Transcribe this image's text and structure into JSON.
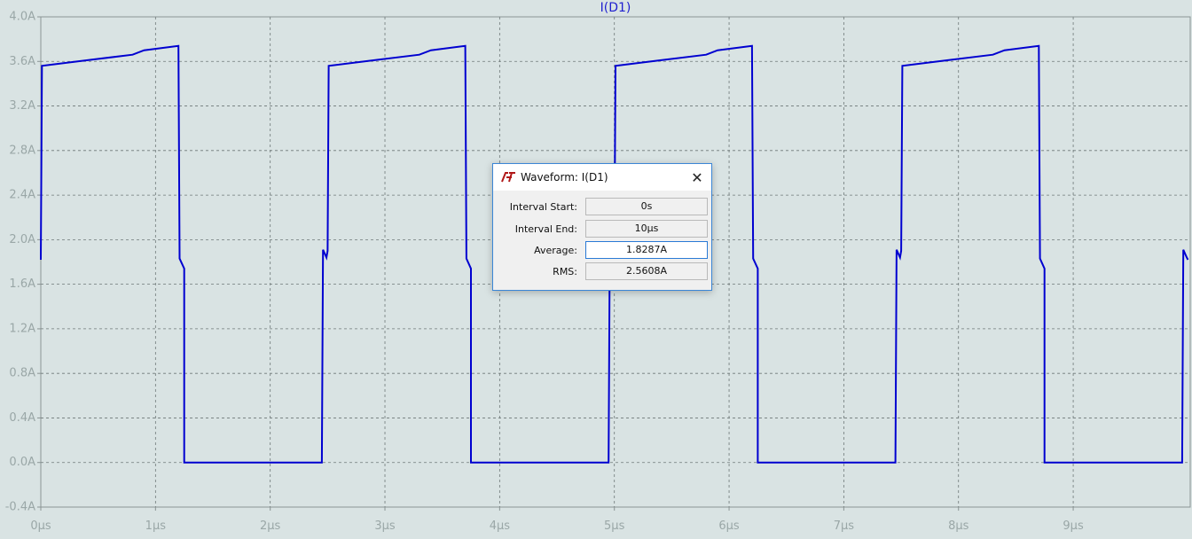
{
  "window": {
    "trace_title": "I(D1)"
  },
  "chart_data": {
    "type": "line",
    "title": "I(D1)",
    "xlabel": "",
    "ylabel": "",
    "xlim": [
      0,
      10
    ],
    "ylim": [
      -0.4,
      4.0
    ],
    "x_ticks": [
      "0µs",
      "1µs",
      "2µs",
      "3µs",
      "4µs",
      "5µs",
      "6µs",
      "7µs",
      "8µs",
      "9µs"
    ],
    "y_ticks": [
      "4.0A",
      "3.6A",
      "3.2A",
      "2.8A",
      "2.4A",
      "2.0A",
      "1.6A",
      "1.2A",
      "0.8A",
      "0.4A",
      "0.0A",
      "-0.4A"
    ],
    "grid": true,
    "series": [
      {
        "name": "I(D1)",
        "color": "#0000d0",
        "x": [
          0,
          0.01,
          0.4,
          0.8,
          0.9,
          1.2,
          1.21,
          1.25,
          1.25,
          2.45,
          2.46,
          2.49,
          2.5,
          2.51,
          2.9,
          3.3,
          3.4,
          3.7,
          3.71,
          3.75,
          3.75,
          4.95,
          4.96,
          4.99,
          5.0,
          5.01,
          5.4,
          5.8,
          5.9,
          6.2,
          6.21,
          6.25,
          6.25,
          7.45,
          7.46,
          7.49,
          7.5,
          7.51,
          7.9,
          8.3,
          8.4,
          8.7,
          8.71,
          8.75,
          8.75,
          9.95,
          9.96,
          9.99,
          10.0
        ],
        "y": [
          1.82,
          3.56,
          3.61,
          3.66,
          3.7,
          3.74,
          1.83,
          1.74,
          0.0,
          0.0,
          1.91,
          1.84,
          1.9,
          3.56,
          3.61,
          3.66,
          3.7,
          3.74,
          1.83,
          1.74,
          0.0,
          0.0,
          1.91,
          1.84,
          1.9,
          3.56,
          3.61,
          3.66,
          3.7,
          3.74,
          1.83,
          1.74,
          0.0,
          0.0,
          1.91,
          1.84,
          1.9,
          3.56,
          3.61,
          3.66,
          3.7,
          3.74,
          1.83,
          1.74,
          0.0,
          0.0,
          1.91,
          1.84,
          1.82
        ]
      }
    ]
  },
  "dialog": {
    "title": "Waveform: I(D1)",
    "logo_icon": "ltspice-logo-icon",
    "close_icon": "close-icon",
    "fields": [
      {
        "label": "Interval Start:",
        "value": "0s"
      },
      {
        "label": "Interval End:",
        "value": "10µs"
      },
      {
        "label": "Average:",
        "value": "1.8287A"
      },
      {
        "label": "RMS:",
        "value": "2.5608A"
      }
    ]
  }
}
